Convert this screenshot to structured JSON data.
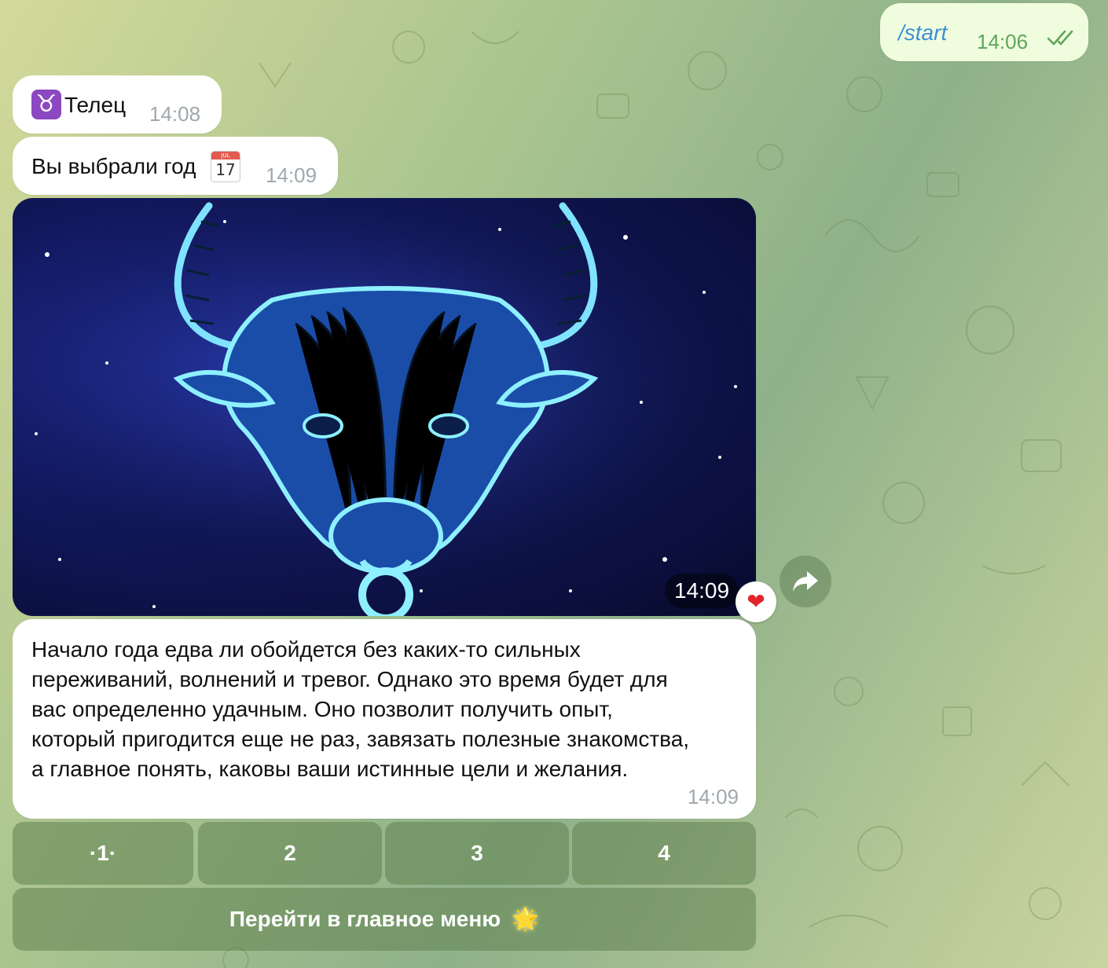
{
  "messages": {
    "start": {
      "text": "/start",
      "time": "14:06"
    },
    "sign": {
      "glyph": "♉",
      "text": "Телец",
      "time": "14:08"
    },
    "year": {
      "text": "Вы выбрали год",
      "calendar_month": "JUL",
      "calendar_day": "17",
      "time": "14:09"
    },
    "photo": {
      "time": "14:09",
      "reaction": "❤"
    },
    "forecast": {
      "lines": [
        "Начало года едва ли обойдется без каких-то сильных",
        "переживаний, волнений и тревог. Однако это время будет для",
        "вас определенно удачным. Оно позволит получить опыт,",
        "который пригодится еще не раз, завязать полезные знакомства,",
        "а главное   понять, каковы ваши истинные цели и желания."
      ],
      "time": "14:09"
    }
  },
  "keyboard": {
    "pages": [
      "·1·",
      "2",
      "3",
      "4"
    ],
    "main_menu": "Перейти в главное меню",
    "main_menu_icon": "🌟"
  },
  "colors": {
    "outgoing_bubble": "#effdde",
    "link_text": "#3e8fd6",
    "keyboard_button": "#6b8c56"
  }
}
